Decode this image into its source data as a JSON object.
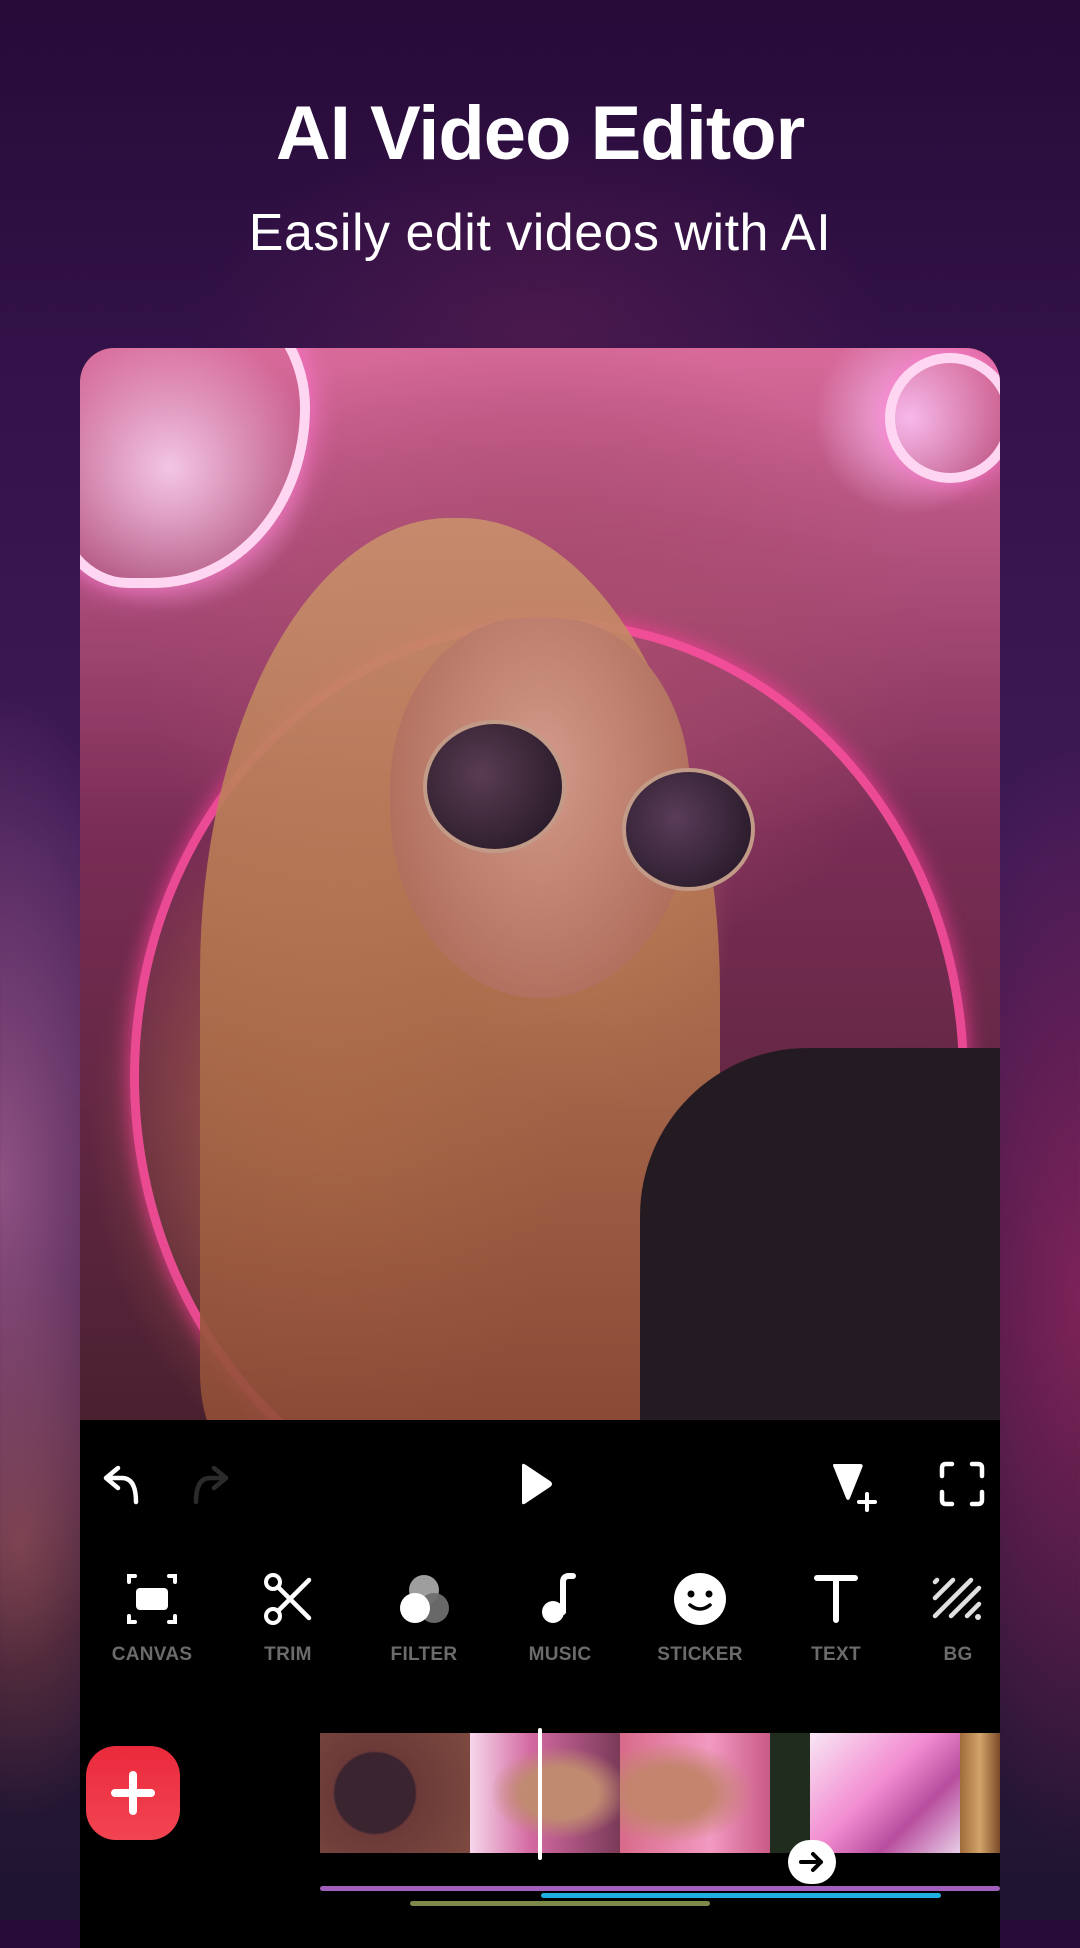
{
  "promo": {
    "title": "AI Video Editor",
    "subtitle": "Easily edit videos with AI"
  },
  "preview": {
    "description": "Young woman with long hair and round sunglasses in front of pink neon lights"
  },
  "controls": {
    "undo_icon": "undo-arrow",
    "redo_icon": "redo-arrow",
    "redo_enabled": false,
    "play_icon": "play-triangle",
    "keyframe_icon": "keyframe-add",
    "fullscreen_icon": "fullscreen-corners"
  },
  "tools": [
    {
      "label": "CANVAS",
      "icon": "canvas"
    },
    {
      "label": "TRIM",
      "icon": "scissors"
    },
    {
      "label": "FILTER",
      "icon": "filter-circles"
    },
    {
      "label": "MUSIC",
      "icon": "music-note"
    },
    {
      "label": "STICKER",
      "icon": "smiley"
    },
    {
      "label": "TEXT",
      "icon": "text-t"
    },
    {
      "label": "BG",
      "icon": "diagonal-stripes"
    }
  ],
  "timeline": {
    "add_clip_icon": "plus",
    "transition_icon": "arrow-right",
    "clips": [
      {
        "name": "clip-1-sunglasses-closeup"
      },
      {
        "name": "clip-2-woman-neon"
      },
      {
        "name": "clip-3-woman-face"
      },
      {
        "name": "clip-4-neon-sign"
      },
      {
        "name": "clip-5-hair"
      }
    ],
    "tracks": [
      {
        "name": "main-audio-track",
        "color": "#a25fbd"
      },
      {
        "name": "music-track",
        "color": "#1eaee0"
      },
      {
        "name": "effect-track",
        "color": "#7d8a4a"
      }
    ],
    "colors": {
      "add_button": "#ee3444",
      "playhead": "#ffffff",
      "tool_label": "#6b6b6b"
    }
  }
}
